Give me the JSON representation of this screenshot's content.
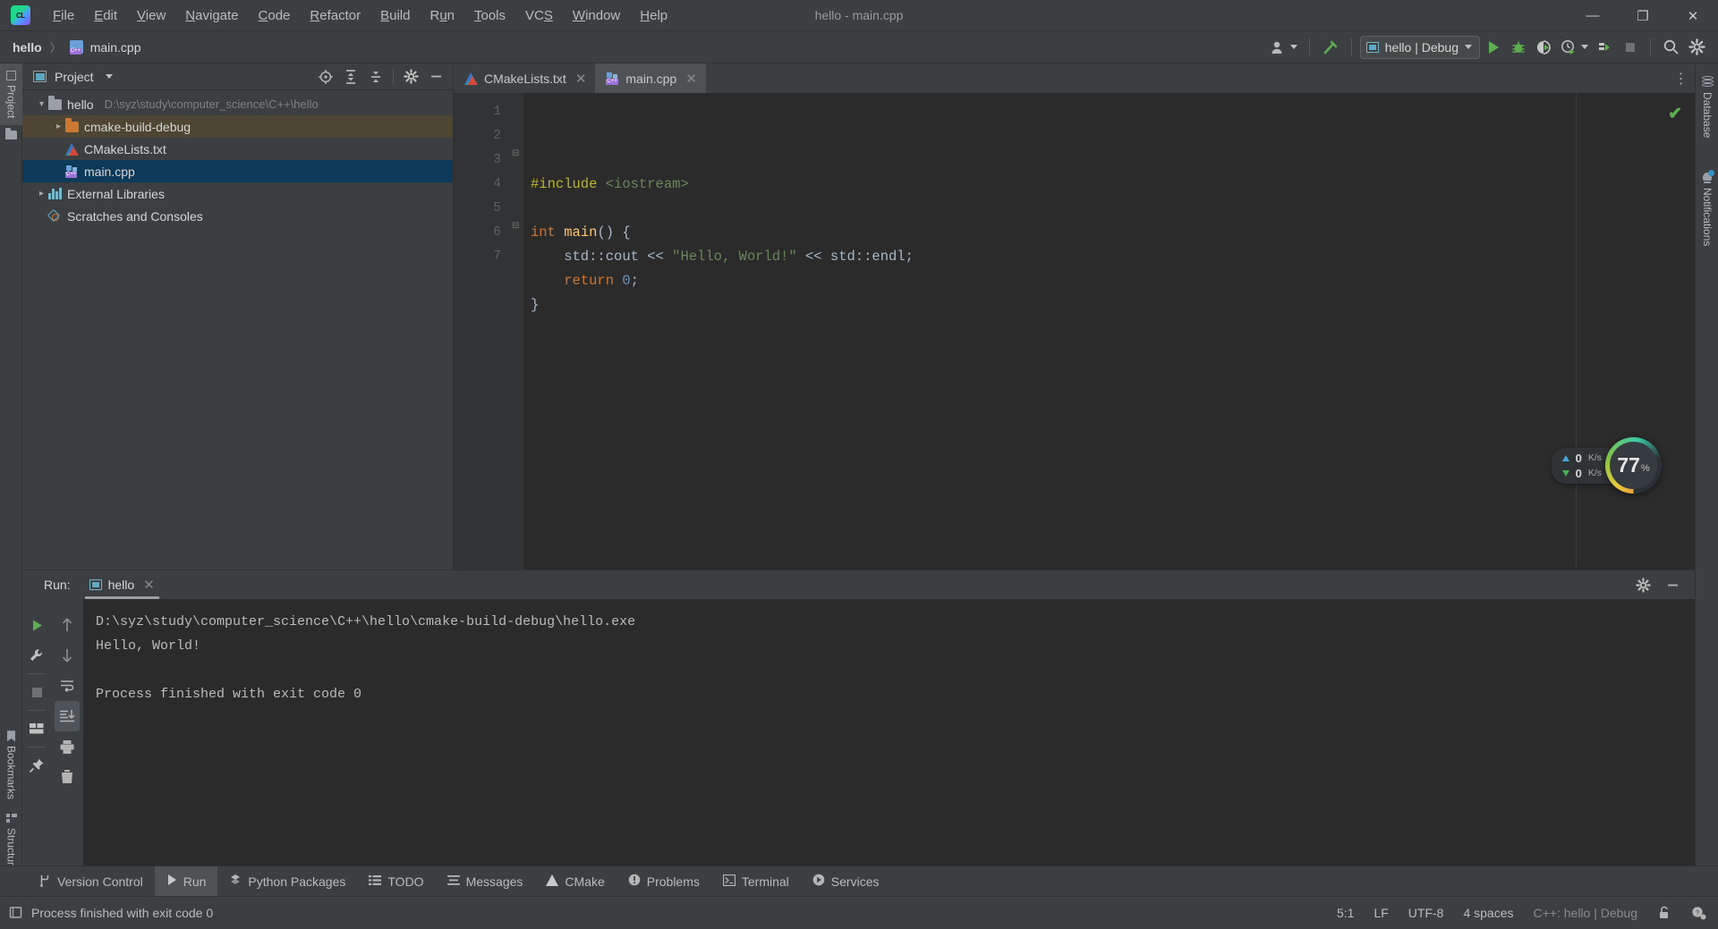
{
  "window": {
    "title": "hello - main.cpp",
    "controls": {
      "minimize": "—",
      "maximize": "❐",
      "close": "✕"
    }
  },
  "menubar": {
    "items": [
      {
        "label": "File",
        "mnemonic": "F"
      },
      {
        "label": "Edit",
        "mnemonic": "E"
      },
      {
        "label": "View",
        "mnemonic": "V"
      },
      {
        "label": "Navigate",
        "mnemonic": "N"
      },
      {
        "label": "Code",
        "mnemonic": "C"
      },
      {
        "label": "Refactor",
        "mnemonic": "R"
      },
      {
        "label": "Build",
        "mnemonic": "B"
      },
      {
        "label": "Run",
        "mnemonic": "u"
      },
      {
        "label": "Tools",
        "mnemonic": "T"
      },
      {
        "label": "VCS",
        "mnemonic": "S"
      },
      {
        "label": "Window",
        "mnemonic": "W"
      },
      {
        "label": "Help",
        "mnemonic": "H"
      }
    ]
  },
  "navbar": {
    "breadcrumb": {
      "project": "hello",
      "separator": "〉",
      "file": "main.cpp"
    },
    "run_config": {
      "label": "hello | Debug"
    },
    "icons": [
      "user-avatar-icon",
      "hammer-build-icon",
      "run-icon",
      "debug-icon",
      "run-with-coverage-icon",
      "profile-icon",
      "attach-process-icon",
      "stop-icon",
      "search-everywhere-icon",
      "settings-gear-icon"
    ]
  },
  "left_rail": {
    "tabs": [
      {
        "label": "Project",
        "icon": "project-panel-icon",
        "active": true
      },
      {
        "label": "Bookmarks",
        "icon": "bookmark-icon",
        "active": false
      },
      {
        "label": "Structure",
        "icon": "structure-icon",
        "active": false
      }
    ]
  },
  "right_rail": {
    "tabs": [
      {
        "label": "Database",
        "icon": "database-icon"
      },
      {
        "label": "Notifications",
        "icon": "bell-icon"
      }
    ]
  },
  "project_panel": {
    "title": "Project",
    "toolbar_icons": [
      "select-opened-file-icon",
      "expand-all-icon",
      "collapse-all-icon",
      "settings-gear-icon",
      "hide-panel-icon"
    ],
    "tree": [
      {
        "label": "hello",
        "path": "D:\\syz\\study\\computer_science\\C++\\hello",
        "icon": "folder-gray-icon",
        "arrow": "down",
        "indent": 0,
        "state": "none"
      },
      {
        "label": "cmake-build-debug",
        "path": "",
        "icon": "folder-orange-icon",
        "arrow": "right",
        "indent": 1,
        "state": "brown"
      },
      {
        "label": "CMakeLists.txt",
        "path": "",
        "icon": "cmake-file-icon",
        "arrow": "none",
        "indent": 1,
        "state": "none"
      },
      {
        "label": "main.cpp",
        "path": "",
        "icon": "cpp-file-icon",
        "arrow": "none",
        "indent": 1,
        "state": "blue"
      },
      {
        "label": "External Libraries",
        "path": "",
        "icon": "library-icon",
        "arrow": "right",
        "indent": 0,
        "state": "none"
      },
      {
        "label": "Scratches and Consoles",
        "path": "",
        "icon": "scratch-icon",
        "arrow": "none",
        "indent": 0,
        "state": "none"
      }
    ]
  },
  "editor": {
    "tabs": [
      {
        "label": "CMakeLists.txt",
        "icon": "cmake-file-icon",
        "active": false
      },
      {
        "label": "main.cpp",
        "icon": "cpp-file-icon",
        "active": true
      }
    ],
    "line_numbers": [
      "1",
      "2",
      "3",
      "4",
      "5",
      "6",
      "7"
    ],
    "code_lines": [
      {
        "n": "1",
        "tokens": [
          {
            "t": "#include ",
            "c": "c-pre"
          },
          {
            "t": "<iostream>",
            "c": "c-hdr"
          }
        ]
      },
      {
        "n": "2",
        "tokens": []
      },
      {
        "n": "3",
        "tokens": [
          {
            "t": "int ",
            "c": "c-kw"
          },
          {
            "t": "main",
            "c": "c-fn"
          },
          {
            "t": "() {",
            "c": "c-txt"
          }
        ]
      },
      {
        "n": "4",
        "tokens": [
          {
            "t": "    std::cout ",
            "c": "c-txt"
          },
          {
            "t": "<< ",
            "c": "c-txt"
          },
          {
            "t": "\"Hello, World!\"",
            "c": "c-str"
          },
          {
            "t": " << ",
            "c": "c-txt"
          },
          {
            "t": "std::endl;",
            "c": "c-txt"
          }
        ]
      },
      {
        "n": "5",
        "tokens": [
          {
            "t": "    ",
            "c": "c-txt"
          },
          {
            "t": "return ",
            "c": "c-kw"
          },
          {
            "t": "0",
            "c": "c-num"
          },
          {
            "t": ";",
            "c": "c-txt"
          }
        ]
      },
      {
        "n": "6",
        "tokens": [
          {
            "t": "}",
            "c": "c-txt"
          }
        ]
      },
      {
        "n": "7",
        "tokens": []
      }
    ],
    "inspection_status": "✔"
  },
  "perf_widget": {
    "upload": {
      "value": "0",
      "unit": "K/s"
    },
    "download": {
      "value": "0",
      "unit": "K/s"
    },
    "cpu": {
      "value": "77",
      "unit": "%"
    }
  },
  "run_window": {
    "label": "Run:",
    "tab": "hello",
    "tab_close": "✕",
    "left_icons": [
      "rerun-icon",
      "wrench-settings-icon",
      "stop-icon",
      "layout-icon",
      "pin-icon"
    ],
    "mid_icons": [
      "up-arrow-icon",
      "down-arrow-icon",
      "soft-wrap-icon",
      "scroll-to-end-icon",
      "print-icon",
      "trash-icon"
    ],
    "head_icons": [
      "settings-gear-icon",
      "hide-panel-icon"
    ],
    "console_lines": [
      "D:\\syz\\study\\computer_science\\C++\\hello\\cmake-build-debug\\hello.exe",
      "Hello, World!",
      "",
      "Process finished with exit code 0"
    ]
  },
  "bottom_tabs": [
    {
      "label": "Version Control",
      "icon": "branch-icon",
      "active": false
    },
    {
      "label": "Run",
      "icon": "run-icon",
      "active": true
    },
    {
      "label": "Python Packages",
      "icon": "python-icon",
      "active": false
    },
    {
      "label": "TODO",
      "icon": "list-icon",
      "active": false
    },
    {
      "label": "Messages",
      "icon": "message-icon",
      "active": false
    },
    {
      "label": "CMake",
      "icon": "cmake-icon",
      "active": false
    },
    {
      "label": "Problems",
      "icon": "warning-icon",
      "active": false
    },
    {
      "label": "Terminal",
      "icon": "terminal-icon",
      "active": false
    },
    {
      "label": "Services",
      "icon": "services-icon",
      "active": false
    }
  ],
  "statusbar": {
    "message": "Process finished with exit code 0",
    "caret": "5:1",
    "line_sep": "LF",
    "encoding": "UTF-8",
    "indent": "4 spaces",
    "toolchain": "C++: hello | Debug",
    "icons": [
      "lock-icon",
      "inspection-level-icon"
    ]
  },
  "colors": {
    "chrome": "#3c3f41",
    "editor_bg": "#2b2b2b",
    "gutter_bg": "#313335",
    "selection_blue": "#0d3a58",
    "selection_brown": "#4e4632",
    "accent_green": "#5fad52",
    "keyword_orange": "#cc7832",
    "string_green": "#6a8759",
    "number_blue": "#6897bb",
    "text_gray": "#a9b7c6",
    "preproc_yellow": "#bbb529"
  }
}
